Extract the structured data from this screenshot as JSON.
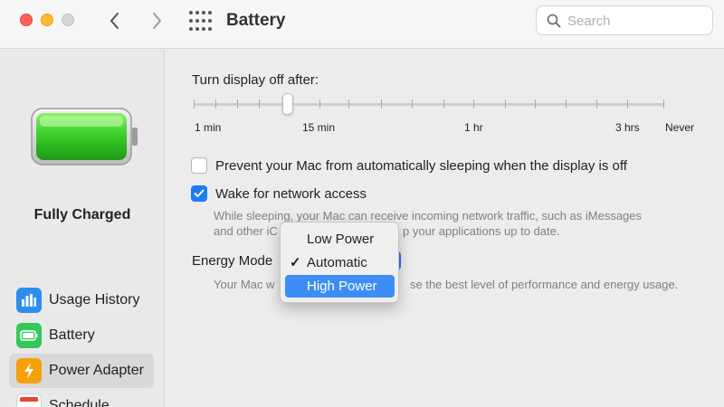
{
  "window": {
    "title": "Battery"
  },
  "search": {
    "placeholder": "Search"
  },
  "sidebar": {
    "status": "Fully Charged",
    "items": [
      {
        "label": "Usage History",
        "icon": "bar-chart-icon",
        "color": "#2e8cf0"
      },
      {
        "label": "Battery",
        "icon": "battery-icon",
        "color": "#34c759"
      },
      {
        "label": "Power Adapter",
        "icon": "lightning-bolt-icon",
        "color": "#f5a00c"
      },
      {
        "label": "Schedule",
        "icon": "calendar-icon",
        "color": "#e94437"
      }
    ]
  },
  "display_off": {
    "title": "Turn display off after:",
    "tick_labels": [
      "1 min",
      "15 min",
      "1 hr",
      "3 hrs",
      "Never"
    ],
    "selected": "15 min"
  },
  "options": {
    "prevent_sleep": {
      "label": "Prevent your Mac from automatically sleeping when the display is off",
      "checked": false
    },
    "wake_network": {
      "label": "Wake for network access",
      "checked": true
    },
    "wake_desc_line1": "While sleeping, your Mac can receive incoming network traffic, such as iMessages",
    "wake_desc_line2_left": "and other iC",
    "wake_desc_line2_right": "p your applications up to date."
  },
  "energy_mode": {
    "label": "Energy Mode",
    "desc_left": "Your Mac w",
    "desc_right": "se the best level of performance and energy usage.",
    "menu": [
      {
        "label": "Low Power",
        "checked": false,
        "highlighted": false
      },
      {
        "label": "Automatic",
        "checked": true,
        "highlighted": false
      },
      {
        "label": "High Power",
        "checked": false,
        "highlighted": true
      }
    ]
  },
  "colors": {
    "accent": "#1f7bf3",
    "highlight": "#3d8df5",
    "battery_green": "#34c759"
  }
}
